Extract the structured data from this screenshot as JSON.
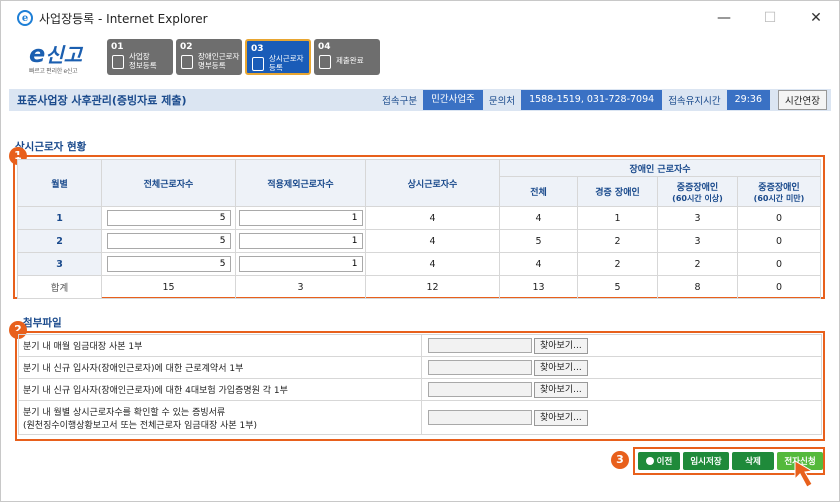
{
  "window": {
    "title": "사업장등록 - Internet Explorer",
    "ie_letter": "e",
    "minimize": "—",
    "maximize": "☐",
    "close": "✕"
  },
  "logo": {
    "main_e": "e",
    "main": "신고",
    "sub": "빠르고 편리한 e신고"
  },
  "steps": [
    {
      "num": "01",
      "label1": "사업장",
      "label2": "정보등록"
    },
    {
      "num": "02",
      "label1": "장애인근로자",
      "label2": "명부등록"
    },
    {
      "num": "03",
      "label1": "상시근로자",
      "label2": "등록"
    },
    {
      "num": "04",
      "label1": "제출완료",
      "label2": ""
    }
  ],
  "infobar": {
    "page_title": "표준사업장 사후관리(증빙자료 제출)",
    "type_label": "접속구분",
    "type_value": "민간사업주",
    "contact_label": "문의처",
    "contact_value": "1588-1519, 031-728-7094",
    "session_label": "접속유지시간",
    "session_value": "29:36",
    "extend_button": "시간연장"
  },
  "section1": {
    "title": "상시근로자 현황",
    "badge": "1",
    "headers": {
      "month": "월별",
      "total": "전체근로자수",
      "excluded": "적용제외근로자수",
      "regular": "상시근로자수",
      "disabled_group": "장애인 근로자수",
      "all": "전체",
      "mild": "경증 장애인",
      "severe_60up": "중증장애인",
      "severe_60up_sub": "(60시간 이상)",
      "severe_60down": "중증장애인",
      "severe_60down_sub": "(60시간 미만)"
    },
    "rows": [
      {
        "month": "1",
        "total": "5",
        "excluded": "1",
        "regular": "4",
        "all": "4",
        "mild": "1",
        "severe_up": "3",
        "severe_down": "0"
      },
      {
        "month": "2",
        "total": "5",
        "excluded": "1",
        "regular": "4",
        "all": "5",
        "mild": "2",
        "severe_up": "3",
        "severe_down": "0"
      },
      {
        "month": "3",
        "total": "5",
        "excluded": "1",
        "regular": "4",
        "all": "4",
        "mild": "2",
        "severe_up": "2",
        "severe_down": "0"
      }
    ],
    "sum": {
      "label": "합계",
      "total": "15",
      "excluded": "3",
      "regular": "12",
      "all": "13",
      "mild": "5",
      "severe_up": "8",
      "severe_down": "0"
    }
  },
  "section2": {
    "title": "첨부파일",
    "badge": "2",
    "find_button": "찾아보기...",
    "items": [
      {
        "label": "분기 내 매월 임금대장 사본 1부",
        "label2": ""
      },
      {
        "label": "분기 내 신규 입사자(장애인근로자)에 대한 근로계약서 1부",
        "label2": ""
      },
      {
        "label": "분기 내 신규 입사자(장애인근로자)에 대한 4대보험 가입증명원 각 1부",
        "label2": ""
      },
      {
        "label": "분기 내 월별 상시근로자수를 확인할 수 있는 증빙서류",
        "label2": "(원천징수이행상황보고서 또는 전체근로자 임금대장 사본 1부)"
      }
    ]
  },
  "actions": {
    "badge": "3",
    "prev": "이전",
    "temp_save": "임시저장",
    "delete": "삭제",
    "submit": "전자신청"
  },
  "colors": {
    "accent": "#e8601c",
    "primary": "#1a5cb8",
    "green": "#1f8a3a"
  }
}
